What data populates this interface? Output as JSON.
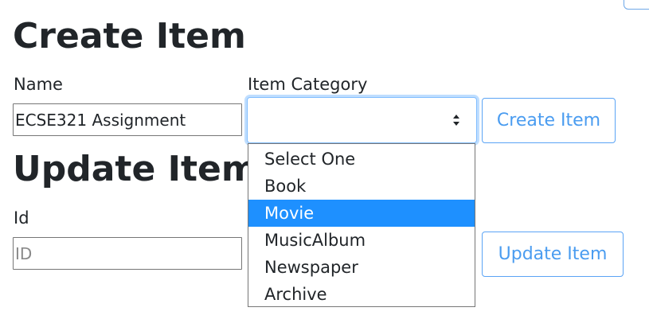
{
  "create": {
    "title": "Create Item",
    "name_label": "Name",
    "name_value": "ECSE321 Assignment",
    "category_label": "Item Category",
    "category_value": "",
    "button_label": "Create Item"
  },
  "update": {
    "title": "Update Item",
    "id_label": "Id",
    "id_placeholder": "ID",
    "button_label": "Update Item"
  },
  "category_dropdown": {
    "options": [
      "Select One",
      "Book",
      "Movie",
      "MusicAlbum",
      "Newspaper",
      "Archive"
    ],
    "highlighted": "Movie"
  },
  "colors": {
    "accent": "#4a9cf0",
    "highlight": "#1e90ff",
    "focus_border": "#80bdff",
    "text": "#212529"
  }
}
